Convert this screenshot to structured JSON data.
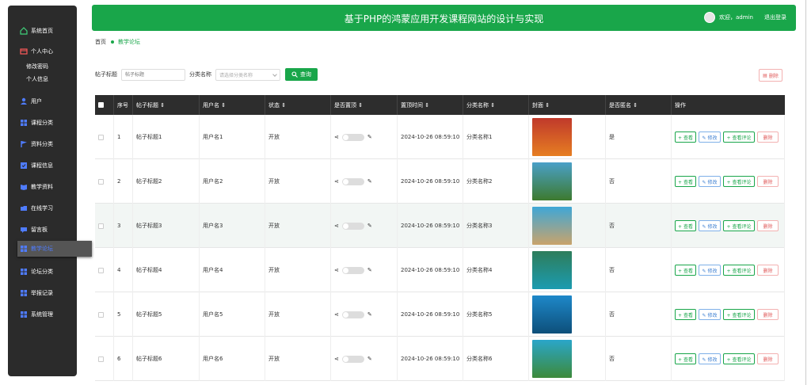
{
  "header": {
    "title": "基于PHP的鸿蒙应用开发课程网站的设计与实现",
    "welcome": "欢迎，admin",
    "logout": "退出登录"
  },
  "sidebar": {
    "items": [
      {
        "label": "系统首页",
        "icon": "home-icon"
      },
      {
        "label": "个人中心",
        "icon": "card-icon"
      },
      {
        "label": "用户",
        "icon": "user-icon"
      },
      {
        "label": "课程分类",
        "icon": "grid-icon"
      },
      {
        "label": "资料分类",
        "icon": "flag-icon"
      },
      {
        "label": "课程信息",
        "icon": "check-square-icon"
      },
      {
        "label": "教学资料",
        "icon": "book-icon"
      },
      {
        "label": "在线学习",
        "icon": "folder-icon"
      },
      {
        "label": "留言板",
        "icon": "message-icon"
      },
      {
        "label": "教学论坛",
        "icon": "grid-icon"
      },
      {
        "label": "论坛分类",
        "icon": "grid-icon"
      },
      {
        "label": "举报记录",
        "icon": "grid-icon"
      },
      {
        "label": "系统管理",
        "icon": "grid-icon"
      }
    ],
    "sub_items": [
      "修改密码",
      "个人信息"
    ]
  },
  "breadcrumb": {
    "home": "首页",
    "current": "教学论坛"
  },
  "search": {
    "title_label": "帖子标题",
    "title_placeholder": "帖子标题",
    "category_label": "分类名称",
    "category_placeholder": "请选择分类名称",
    "query_button": "查询"
  },
  "toolbar": {
    "delete_label": "删除"
  },
  "table": {
    "headers": [
      "序号",
      "帖子标题 ⇕",
      "用户名 ⇕",
      "状态 ⇕",
      "是否置顶 ⇕",
      "置顶时间 ⇕",
      "分类名称 ⇕",
      "封面 ⇕",
      "是否匿名 ⇕",
      "操作"
    ],
    "rows": [
      {
        "no": "1",
        "title": "帖子标题1",
        "user": "用户名1",
        "status": "开放",
        "time": "2024-10-26 08:59:10",
        "category": "分类名称1",
        "anon": "是"
      },
      {
        "no": "2",
        "title": "帖子标题2",
        "user": "用户名2",
        "status": "开放",
        "time": "2024-10-26 08:59:10",
        "category": "分类名称2",
        "anon": "否"
      },
      {
        "no": "3",
        "title": "帖子标题3",
        "user": "用户名3",
        "status": "开放",
        "time": "2024-10-26 08:59:10",
        "category": "分类名称3",
        "anon": "否"
      },
      {
        "no": "4",
        "title": "帖子标题4",
        "user": "用户名4",
        "status": "开放",
        "time": "2024-10-26 08:59:10",
        "category": "分类名称4",
        "anon": "否"
      },
      {
        "no": "5",
        "title": "帖子标题5",
        "user": "用户名5",
        "status": "开放",
        "time": "2024-10-26 08:59:10",
        "category": "分类名称5",
        "anon": "否"
      },
      {
        "no": "6",
        "title": "帖子标题6",
        "user": "用户名6",
        "status": "开放",
        "time": "2024-10-26 08:59:10",
        "category": "分类名称6",
        "anon": "否"
      }
    ],
    "actions": {
      "view": "+ 查看",
      "edit": "✎ 修改",
      "comments": "+ 查看评论",
      "delete": "删除"
    }
  },
  "colors": {
    "brand": "#19a64a",
    "sidebar": "#2b2b2b",
    "table_header": "#2d2d2d"
  }
}
